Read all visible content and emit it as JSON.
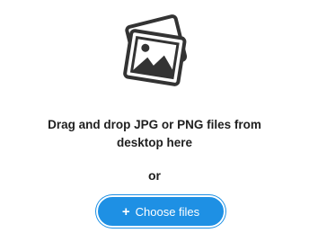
{
  "dropzone": {
    "icon": "images-icon",
    "instruction_line1": "Drag and drop JPG or PNG files from",
    "instruction_line2": "desktop here",
    "separator": "or",
    "button": {
      "icon": "plus-icon",
      "icon_glyph": "+",
      "label": "Choose files",
      "color": "#1e90e4"
    }
  }
}
